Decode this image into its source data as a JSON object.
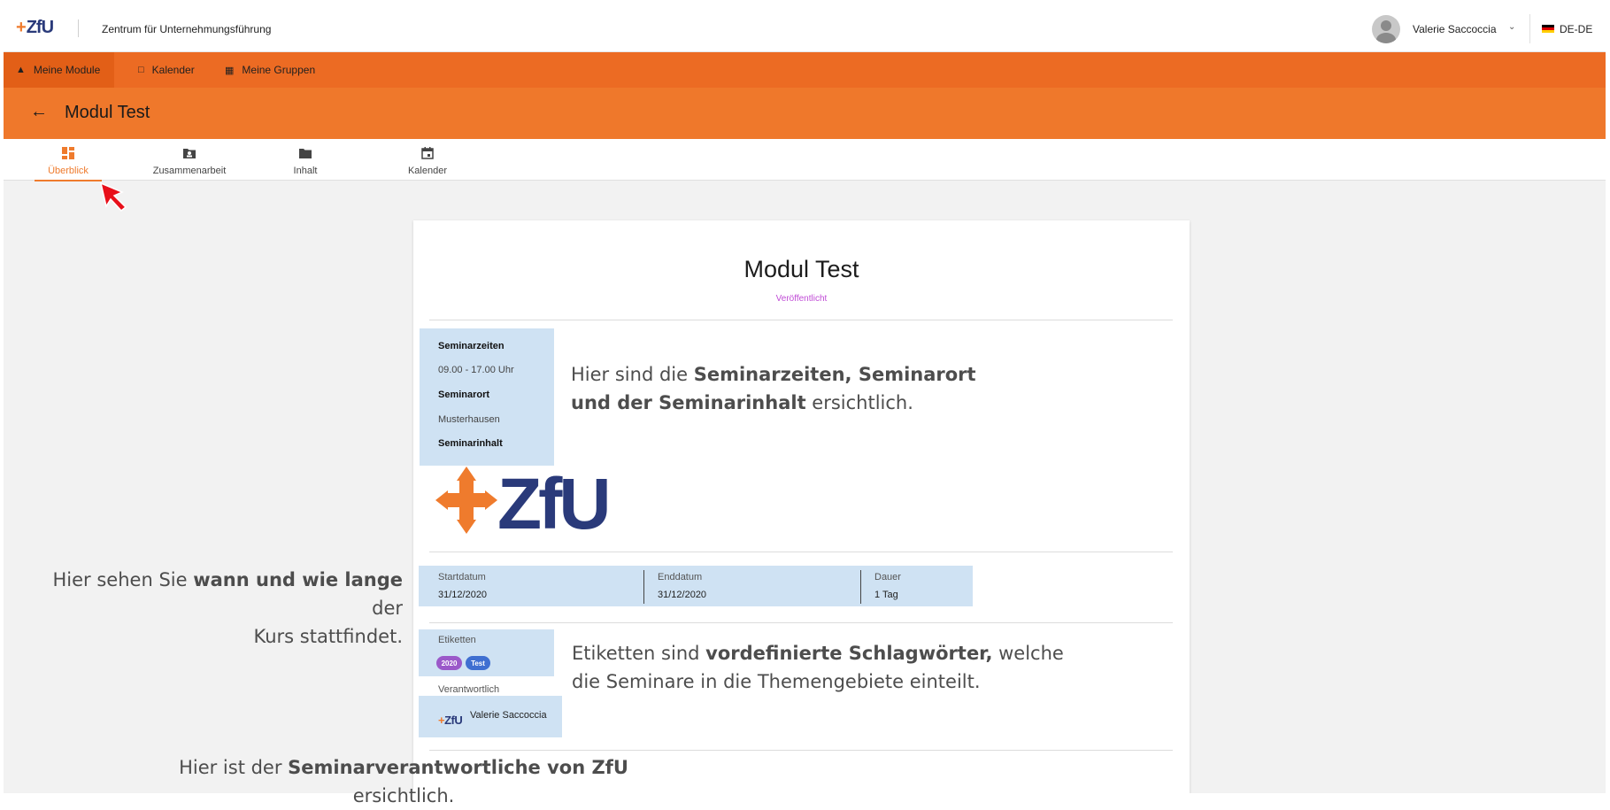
{
  "header": {
    "logo_text": "ZfU",
    "org_name": "Zentrum für Unternehmungsführung",
    "user_name": "Valerie Saccoccia",
    "language": "DE-DE"
  },
  "nav": {
    "items": [
      {
        "label": "Meine Module",
        "icon": "home-icon"
      },
      {
        "label": "Kalender",
        "icon": "calendar-icon"
      },
      {
        "label": "Meine Gruppen",
        "icon": "groups-icon"
      }
    ]
  },
  "module": {
    "back_icon": "back-arrow-icon",
    "title": "Modul Test"
  },
  "tabs": [
    {
      "label": "Überblick",
      "icon": "dashboard-icon",
      "active": true
    },
    {
      "label": "Zusammenarbeit",
      "icon": "contact-folder-icon"
    },
    {
      "label": "Inhalt",
      "icon": "folder-icon"
    },
    {
      "label": "Kalender",
      "icon": "event-icon"
    }
  ],
  "card": {
    "title": "Modul Test",
    "status": "Veröffentlicht",
    "info": {
      "zeiten_label": "Seminarzeiten",
      "zeiten_value": "09.00 - 17.00 Uhr",
      "ort_label": "Seminarort",
      "ort_value": "Musterhausen",
      "inhalt_label": "Seminarinhalt"
    },
    "logo_text": "ZfU",
    "dates": {
      "start_label": "Startdatum",
      "start_value": "31/12/2020",
      "end_label": "Enddatum",
      "end_value": "31/12/2020",
      "duration_label": "Dauer",
      "duration_value": "1 Tag"
    },
    "tags_label": "Etiketten",
    "tags": [
      "2020",
      "Test"
    ],
    "responsible_label": "Verantwortlich",
    "responsible_name": "Valerie Saccoccia"
  },
  "annotations": {
    "seminar": {
      "p1": "Hier sind die ",
      "b1": "Seminarzeiten, Seminarort",
      "b2": "und der Seminarinhalt",
      "p2": " ersichtlich."
    },
    "dates": {
      "p1": "Hier sehen Sie ",
      "b1": "wann und wie lange",
      "p2": " der",
      "p3": "Kurs stattfindet."
    },
    "tags": {
      "p1": "Etiketten sind ",
      "b1": "vordefinierte Schlagwörter,",
      "p2": " welche",
      "p3": "die Seminare in die Themengebiete einteilt."
    },
    "responsible": {
      "p1": "Hier ist der ",
      "b1": "Seminarverantwortliche von ZfU",
      "p2": "ersichtlich."
    }
  },
  "colors": {
    "orange_nav": "#ec6b23",
    "orange_title": "#ef782b",
    "highlight": "#cfe2f3",
    "chip_2020": "#9b59c9",
    "chip_test": "#3f6fd1",
    "status": "#c04bd6"
  }
}
